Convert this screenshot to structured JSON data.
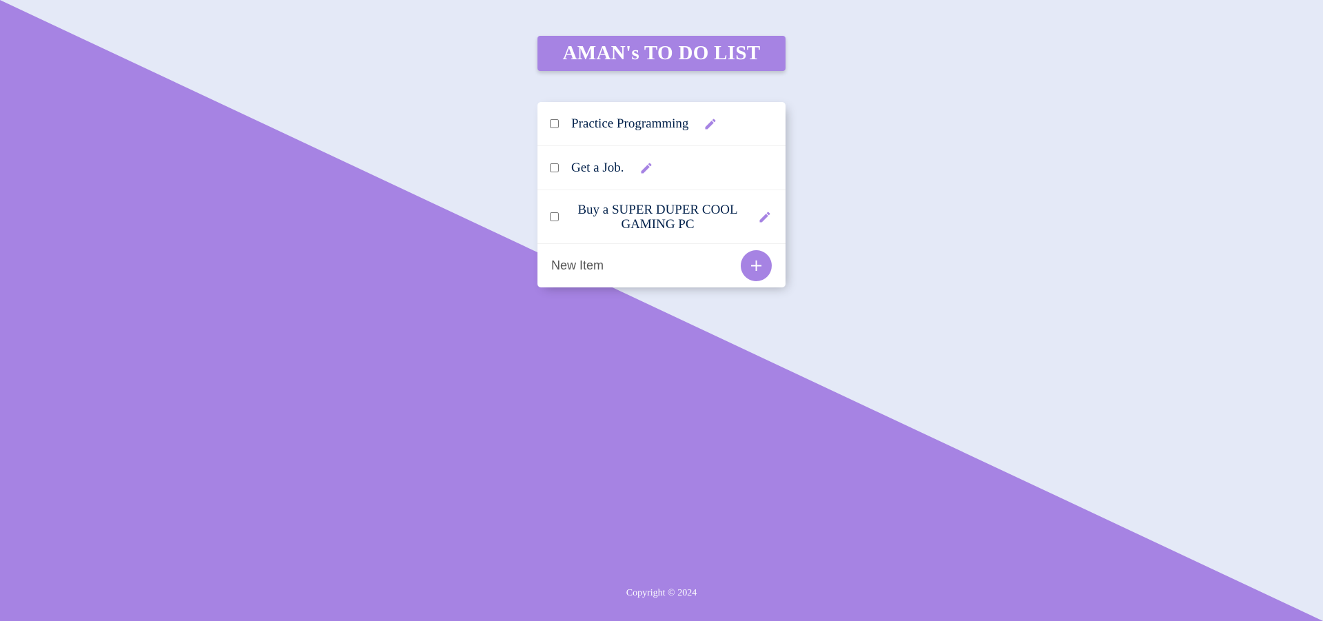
{
  "colors": {
    "accent": "#A683E3",
    "background": "#E4E9F7",
    "item_text": "#00204A",
    "card": "#FFFFFF"
  },
  "header": {
    "title": "AMAN's TO DO LIST"
  },
  "todo": {
    "items": [
      {
        "label": "Practice Programming",
        "checked": false,
        "edit_icon": "pencil-icon"
      },
      {
        "label": "Get a Job.",
        "checked": false,
        "edit_icon": "pencil-icon"
      },
      {
        "label": "Buy a SUPER DUPER COOL GAMING PC",
        "checked": false,
        "edit_icon": "pencil-icon"
      }
    ],
    "new_item": {
      "placeholder": "New Item",
      "value": "",
      "add_label": "+"
    }
  },
  "footer": {
    "copyright": "Copyright © 2024"
  }
}
